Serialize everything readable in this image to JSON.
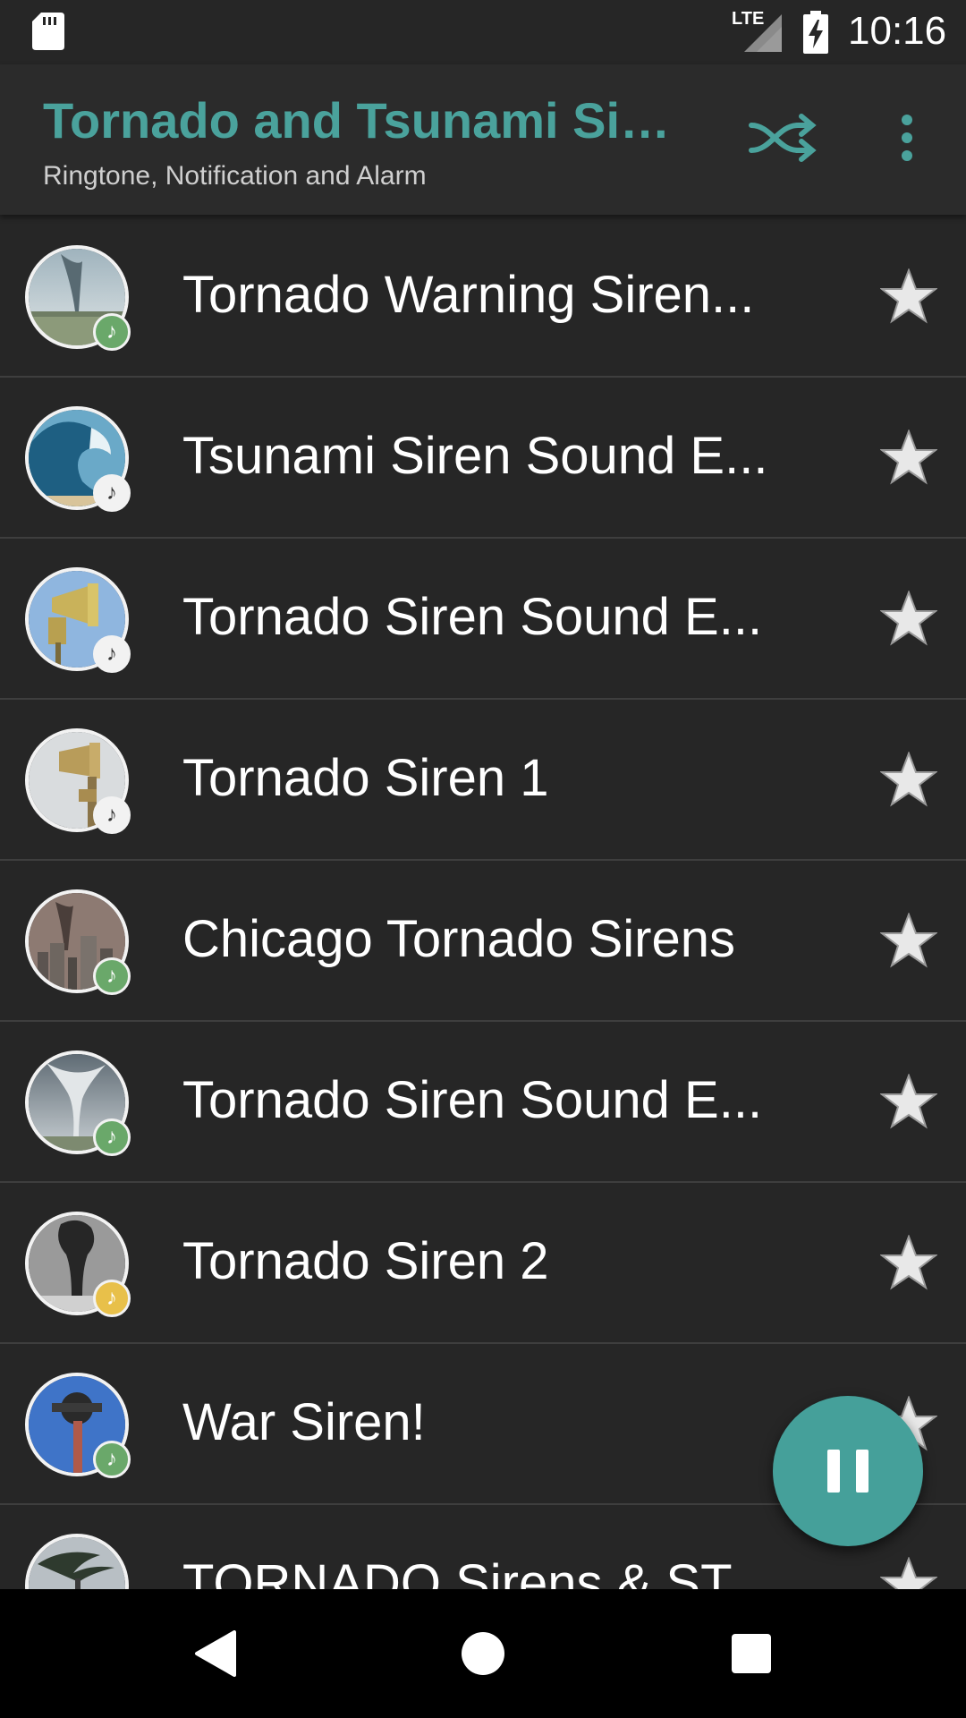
{
  "status_bar": {
    "network": "LTE",
    "time": "10:16",
    "icons": [
      "sd-card-icon",
      "signal-icon",
      "battery-charging-icon"
    ]
  },
  "app_bar": {
    "title": "Tornado and Tsunami Sir...",
    "subtitle": "Ringtone, Notification and Alarm",
    "actions": [
      "shuffle-icon",
      "more-vert-icon"
    ]
  },
  "colors": {
    "accent": "#4aa29c",
    "background": "#262626",
    "app_bar": "#2b2b2b",
    "divider": "#3e3e3e",
    "badge_green": "#6aa86a",
    "badge_white": "#f2f2f2",
    "badge_yellow": "#e8c04a"
  },
  "sounds": [
    {
      "title": "Tornado Warning Siren...",
      "badge": "green",
      "thumbnail": "tornado-funnel"
    },
    {
      "title": "Tsunami Siren Sound E...",
      "badge": "white",
      "thumbnail": "ocean-wave"
    },
    {
      "title": "Tornado Siren Sound E...",
      "badge": "white",
      "thumbnail": "siren-horn-sky"
    },
    {
      "title": "Tornado Siren 1",
      "badge": "white",
      "thumbnail": "siren-horn-pale"
    },
    {
      "title": "Chicago Tornado Sirens",
      "badge": "green",
      "thumbnail": "tornado-city"
    },
    {
      "title": "Tornado Siren Sound E...",
      "badge": "green",
      "thumbnail": "tornado-grey"
    },
    {
      "title": "Tornado Siren 2",
      "badge": "yellow",
      "thumbnail": "smoke-column"
    },
    {
      "title": "War Siren!",
      "badge": "green",
      "thumbnail": "siren-tower"
    },
    {
      "title": "TORNADO Sirens & ST...",
      "badge": "green",
      "thumbnail": "palm-storm"
    }
  ],
  "player": {
    "state_icon": "pause-icon"
  },
  "nav_bar": {
    "buttons": [
      "back-icon",
      "home-icon",
      "recents-icon"
    ]
  }
}
